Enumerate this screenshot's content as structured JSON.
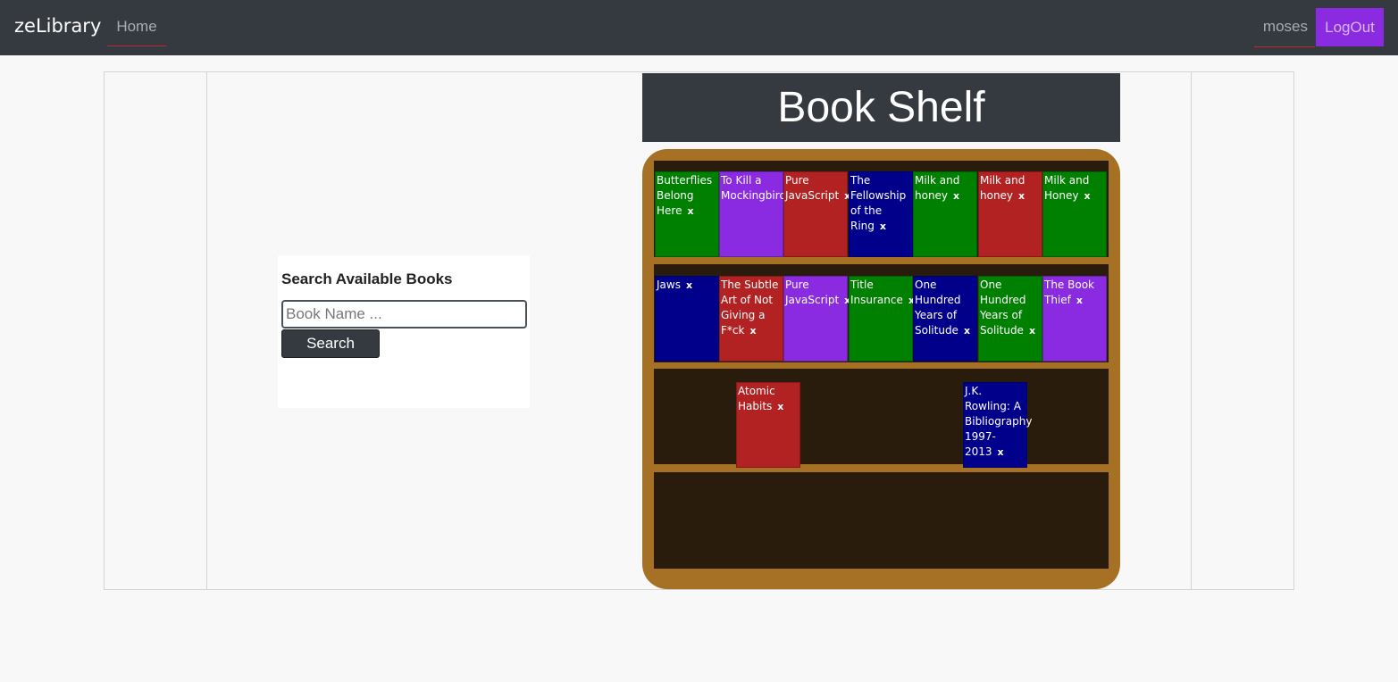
{
  "navbar": {
    "brand": "zeLibrary",
    "home_label": "Home",
    "username": "moses",
    "logout_label": "LogOut"
  },
  "search": {
    "title": "Search Available Books",
    "placeholder": "Book Name ...",
    "value": "",
    "button_label": "Search"
  },
  "shelf": {
    "title": "Book Shelf",
    "remove_symbol": "x",
    "rows": [
      {
        "books": [
          {
            "title": "Butterflies Belong Here",
            "color": "green"
          },
          {
            "title": "To Kill a Mockingbird",
            "color": "purple"
          },
          {
            "title": "Pure JavaScript",
            "color": "red"
          },
          {
            "title": "The Fellowship of the Ring",
            "color": "navy"
          },
          {
            "title": "Milk and honey",
            "color": "green"
          },
          {
            "title": "Milk and honey",
            "color": "red"
          },
          {
            "title": "Milk and Honey",
            "color": "green"
          }
        ]
      },
      {
        "books": [
          {
            "title": "Jaws",
            "color": "navy"
          },
          {
            "title": "The Subtle Art of Not Giving a F*ck",
            "color": "red"
          },
          {
            "title": "Pure JavaScript",
            "color": "purple"
          },
          {
            "title": "Title Insurance",
            "color": "green"
          },
          {
            "title": "One Hundred Years of Solitude",
            "color": "navy"
          },
          {
            "title": "One Hundred Years of Solitude",
            "color": "green"
          },
          {
            "title": "The Book Thief",
            "color": "purple"
          }
        ]
      },
      {
        "books": [
          {
            "title": "Atomic Habits",
            "color": "red"
          },
          {
            "title": "J.K. Rowling: A Bibliography 1997-2013",
            "color": "navy"
          }
        ]
      },
      {
        "books": []
      }
    ]
  }
}
